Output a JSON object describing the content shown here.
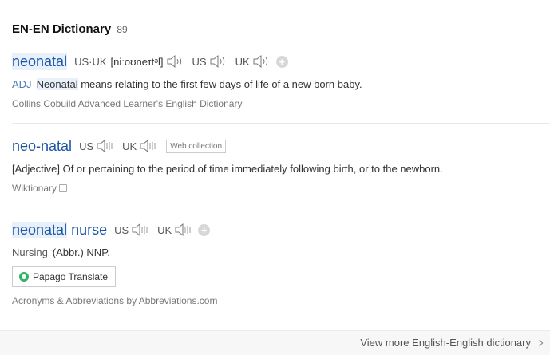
{
  "section": {
    "title": "EN-EN Dictionary",
    "count": "89"
  },
  "entries": [
    {
      "word": "neonatal",
      "pron_label": "US·UK",
      "ipa": "[niːoʊneɪtᵊl]",
      "us": "US",
      "uk": "UK",
      "pos": "ADJ",
      "def_highlight": "Neonatal",
      "def_rest": " means relating to the first few days of life of a new born baby.",
      "source": "Collins Cobuild Advanced Learner's English Dictionary"
    },
    {
      "word": "neo-natal",
      "us": "US",
      "uk": "UK",
      "tag": "Web collection",
      "definition": "[Adjective] Of or pertaining to the period of time immediately following birth, or to the newborn.",
      "source": "Wiktionary"
    },
    {
      "word_hl": "neonatal",
      "word_rest": " nurse",
      "us": "US",
      "uk": "UK",
      "category": "Nursing",
      "definition": "(Abbr.) NNP.",
      "translate_btn": "Papago Translate",
      "source": "Acronyms & Abbreviations by Abbreviations.com"
    }
  ],
  "footer": {
    "more_link": "View more English-English dictionary"
  }
}
